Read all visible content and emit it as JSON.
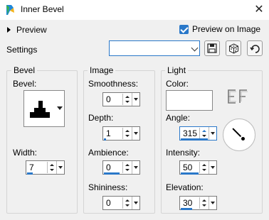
{
  "window": {
    "title": "Inner Bevel"
  },
  "preview": {
    "label": "Preview",
    "preview_on_image_label": "Preview on Image",
    "preview_on_image_checked": true
  },
  "settings": {
    "label": "Settings",
    "value": ""
  },
  "bevel_group": {
    "title": "Bevel",
    "bevel_label": "Bevel:",
    "width_label": "Width:",
    "width_value": "7"
  },
  "image_group": {
    "title": "Image",
    "smoothness_label": "Smoothness:",
    "smoothness_value": "0",
    "depth_label": "Depth:",
    "depth_value": "1",
    "ambience_label": "Ambience:",
    "ambience_value": "0",
    "shininess_label": "Shininess:",
    "shininess_value": "0"
  },
  "light_group": {
    "title": "Light",
    "color_label": "Color:",
    "color_value": "#ffffff",
    "angle_label": "Angle:",
    "angle_value": "315",
    "intensity_label": "Intensity:",
    "intensity_value": "50",
    "elevation_label": "Elevation:",
    "elevation_value": "30"
  },
  "colors": {
    "accent": "#2a78c9"
  }
}
